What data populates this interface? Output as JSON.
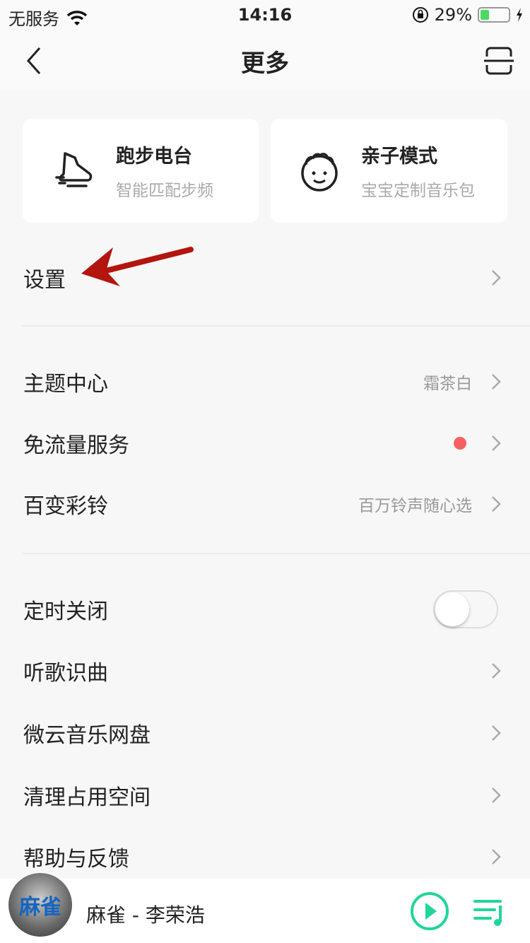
{
  "status": {
    "carrier": "无服务",
    "time": "14:16",
    "battery": "29%",
    "battery_level": 0.29
  },
  "nav": {
    "title": "更多"
  },
  "cards": [
    {
      "title": "跑步电台",
      "subtitle": "智能匹配步频",
      "icon": "running-shoe-icon"
    },
    {
      "title": "亲子模式",
      "subtitle": "宝宝定制音乐包",
      "icon": "baby-face-icon"
    }
  ],
  "rows": [
    {
      "label": "设置"
    },
    {
      "label": "主题中心",
      "value": "霜茶白"
    },
    {
      "label": "免流量服务"
    },
    {
      "label": "百变彩铃",
      "value": "百万铃声随心选"
    },
    {
      "label": "定时关闭",
      "toggle": false
    },
    {
      "label": "听歌识曲"
    },
    {
      "label": "微云音乐网盘"
    },
    {
      "label": "清理占用空间"
    },
    {
      "label": "帮助与反馈"
    }
  ],
  "player": {
    "song": "麻雀 - 李荣浩",
    "cover_text": "麻雀",
    "accent": "#22d59b"
  },
  "colors": {
    "badge_dot": "#f76060",
    "arrow_annotation": "#b3150f"
  }
}
